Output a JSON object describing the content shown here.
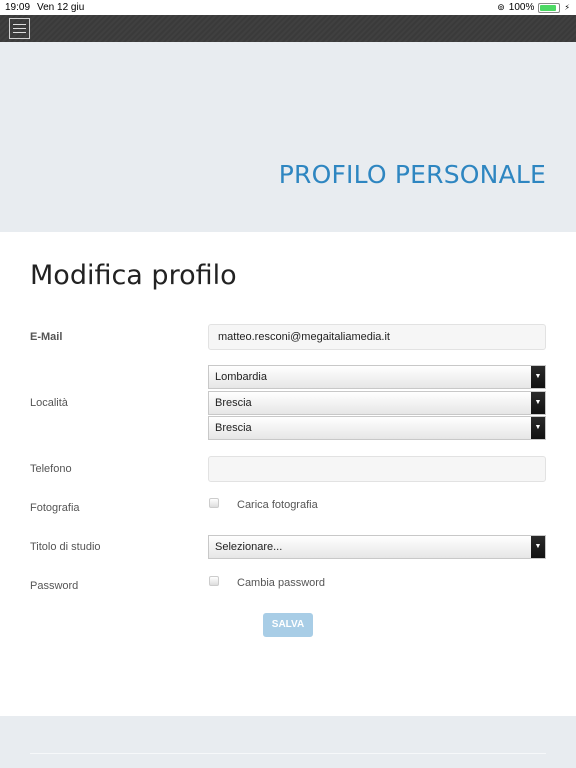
{
  "status_bar": {
    "time": "19:09",
    "date": "Ven 12 giu",
    "battery": "100%",
    "battery_level": 1.0
  },
  "hero": {
    "title": "PROFILO PERSONALE"
  },
  "form": {
    "title": "Modifica profilo",
    "email": {
      "label": "E-Mail",
      "value": "matteo.resconi@megaitaliamedia.it"
    },
    "location": {
      "label": "Località",
      "region": "Lombardia",
      "province": "Brescia",
      "city": "Brescia"
    },
    "phone": {
      "label": "Telefono",
      "value": ""
    },
    "photo": {
      "label": "Fotografia",
      "checkbox_label": "Carica fotografia",
      "checked": false
    },
    "education": {
      "label": "Titolo di studio",
      "value": "Selezionare..."
    },
    "password": {
      "label": "Password",
      "checkbox_label": "Cambia password",
      "checked": false
    },
    "save_label": "SALVA"
  },
  "colors": {
    "accent": "#2e86c1",
    "save_button": "#a8cde6",
    "topbar": "#3a3a3a",
    "hero_bg": "#e8ecf0"
  }
}
